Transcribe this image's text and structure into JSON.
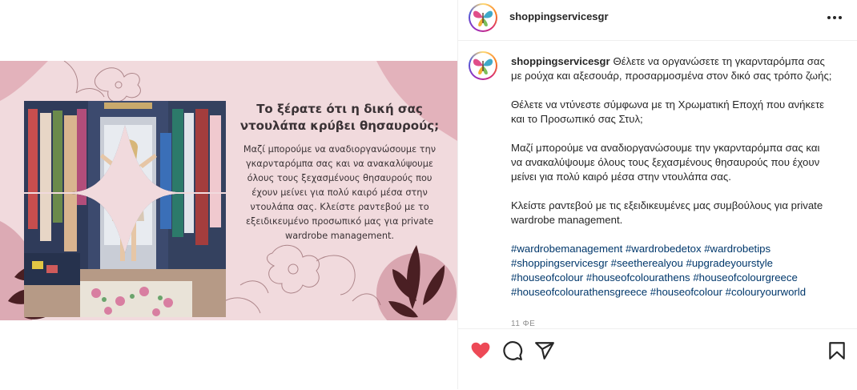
{
  "post": {
    "image_title": "Το ξέρατε ότι η δική σας ντουλάπα κρύβει θησαυρούς;",
    "image_body": "Μαζί μπορούμε να αναδιοργανώσουμε την γκαρνταρόμπα σας και να ανακαλύψουμε όλους τους ξεχασμένους θησαυρούς που έχουν μείνει για πολύ καιρό μέσα στην ντουλάπα σας. Κλείστε ραντεβού με το εξειδικευμένο προσωπικό μας για private wardrobe management.",
    "colors": {
      "background": "#f1dadd",
      "accent": "#d9a6b0",
      "leaf": "#4a1f23"
    }
  },
  "header": {
    "username": "shoppingservicesgr",
    "more_icon": "more-horizontal-icon"
  },
  "caption": {
    "username": "shoppingservicesgr",
    "paragraphs": [
      "Θέλετε να οργανώσετε τη γκαρνταρόμπα σας με ρούχα και αξεσουάρ, προσαρμοσμένα στον δικό σας τρόπο ζωής;",
      "Θέλετε να ντύνεστε σύμφωνα με τη Χρωματική Εποχή που ανήκετε και το Προσωπικό σας Στυλ;",
      "Μαζί μπορούμε να αναδιοργανώσουμε την γκαρνταρόμπα σας και να ανακαλύψουμε όλους τους ξεχασμένους θησαυρούς που έχουν μείνει για πολύ καιρό μέσα στην ντουλάπα σας.",
      "Κλείστε ραντεβού με τις εξειδικευμένες μας συμβούλους για private wardrobe management."
    ],
    "hashtags": [
      "#wardrobemanagement",
      "#wardrobedetox",
      "#wardrobetips",
      "#shoppingservicesgr",
      "#seetherealyou",
      "#upgradeyourstyle",
      "#houseofcolour",
      "#houseofcolourathens",
      "#houseofcolourgreece",
      "#houseofcolourathensgreece",
      "#houseofcolour",
      "#colouryourworld"
    ]
  },
  "timestamp": "11 ΦΕ",
  "actions": {
    "like": "heart-icon",
    "comment": "comment-icon",
    "share": "share-icon",
    "save": "bookmark-icon",
    "like_color": "#ed4956"
  }
}
